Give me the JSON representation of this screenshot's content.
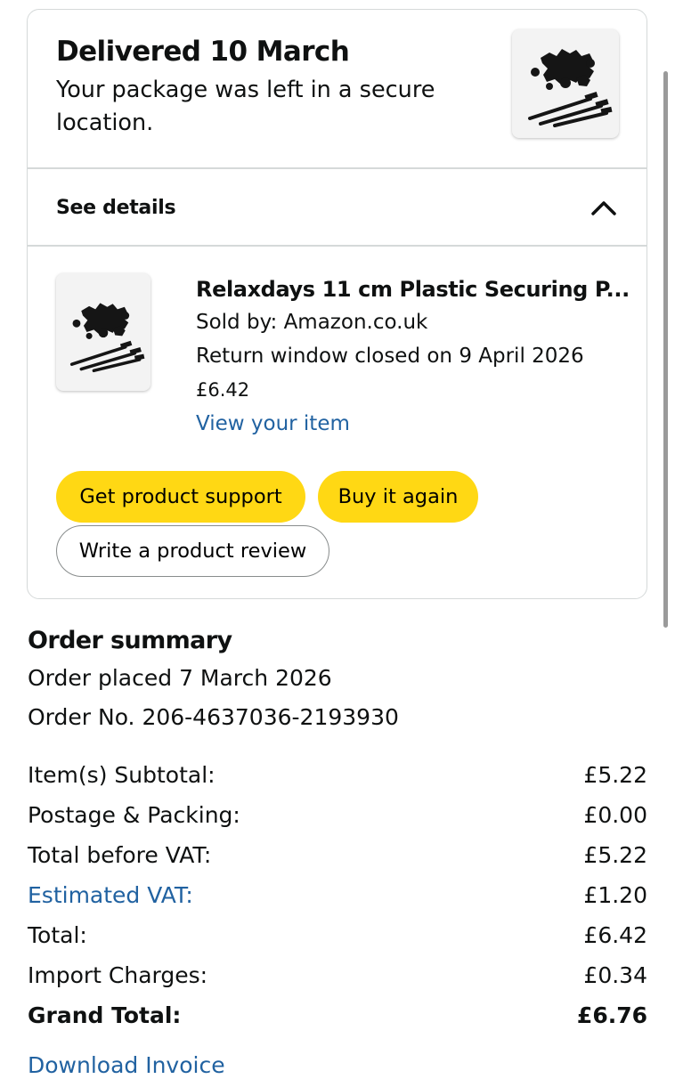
{
  "delivery": {
    "status_title": "Delivered 10 March",
    "status_description": "Your package was left in a secure location."
  },
  "details": {
    "label": "See details",
    "toggle_icon": "chevron-up-icon"
  },
  "item": {
    "title": "Relaxdays 11 cm Plastic Securing P...",
    "sold_by": "Sold by: Amazon.co.uk",
    "return_window": "Return window closed on 9 April 2026",
    "price": "£6.42",
    "view_link": "View your item",
    "image_icon": "ground-pegs-product-image"
  },
  "actions": {
    "product_support": "Get product support",
    "buy_again": "Buy it again",
    "write_review": "Write a product review"
  },
  "summary": {
    "title": "Order summary",
    "placed": "Order placed 7 March 2026",
    "order_no": "Order No. 206-4637036-2193930",
    "rows": [
      {
        "label": "Item(s) Subtotal:",
        "value": "£5.22"
      },
      {
        "label": "Postage & Packing:",
        "value": "£0.00"
      },
      {
        "label": "Total before VAT:",
        "value": "£5.22"
      },
      {
        "label": "Estimated VAT:",
        "value": "£1.20"
      },
      {
        "label": "Total:",
        "value": "£6.42"
      },
      {
        "label": "Import Charges:",
        "value": "£0.34"
      },
      {
        "label": "Grand Total:",
        "value": "£6.76"
      }
    ]
  },
  "footer": {
    "download_invoice": "Download Invoice"
  },
  "colors": {
    "link": "#2162a1",
    "button_yellow": "#ffd814",
    "border": "#d5d9d9"
  }
}
